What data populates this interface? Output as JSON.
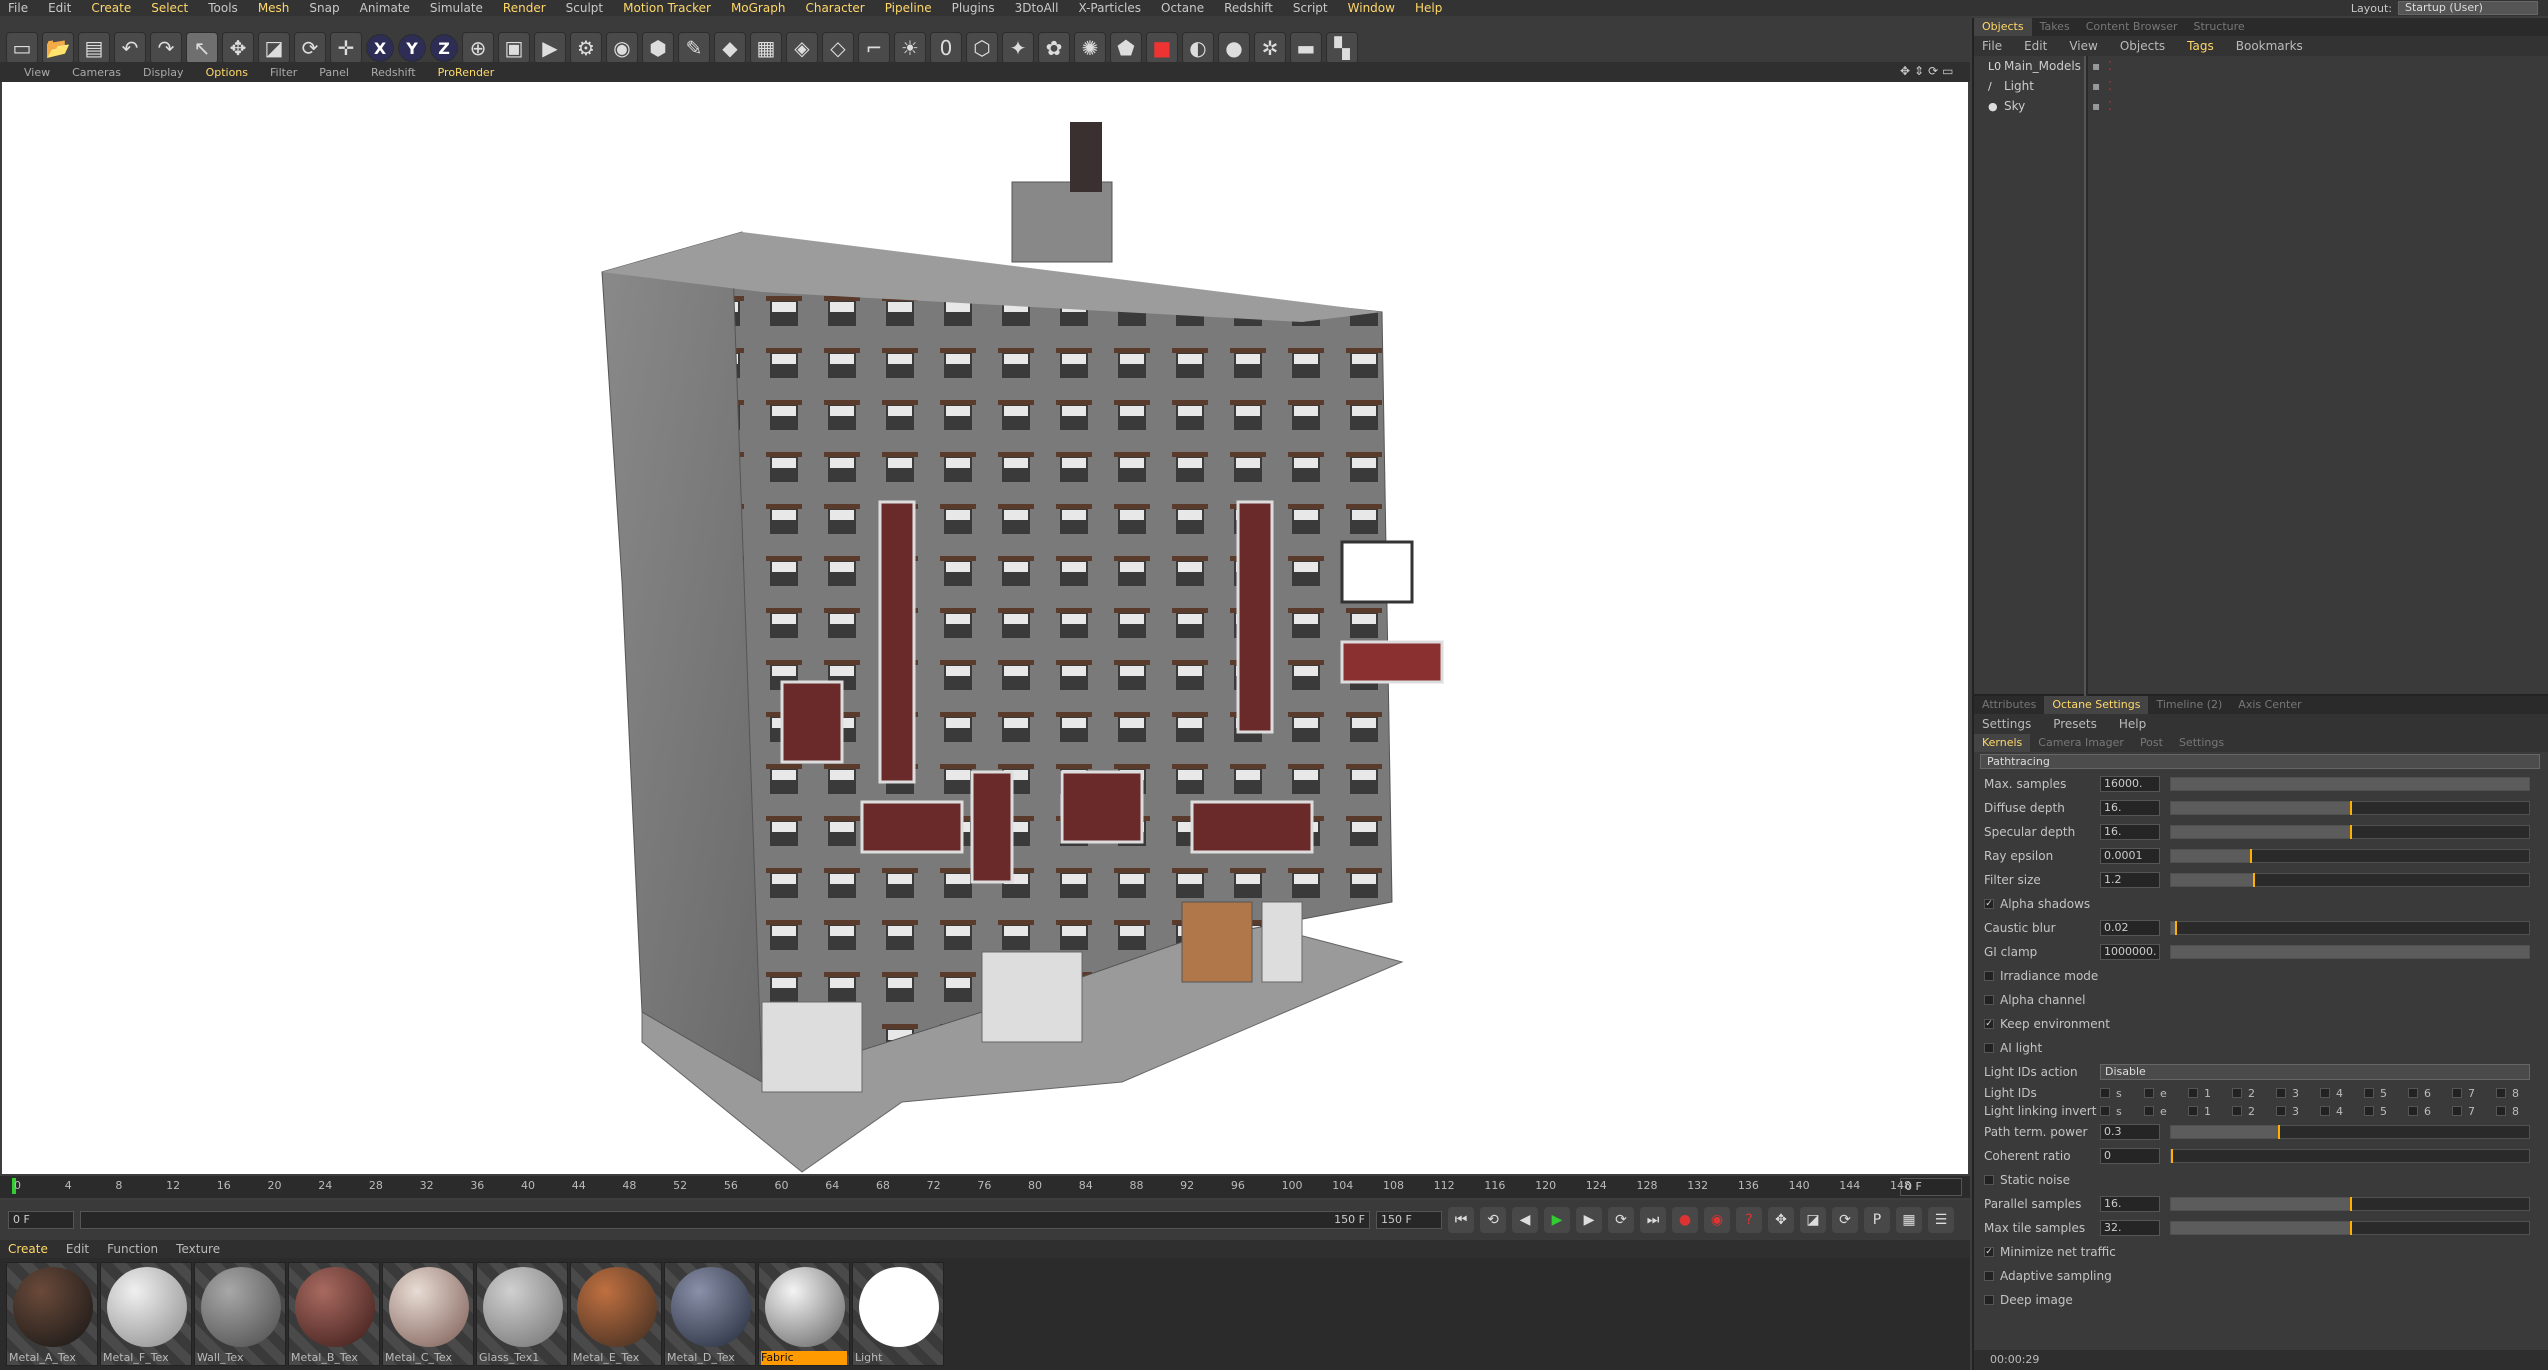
{
  "menu": [
    "File",
    "Edit",
    "Create",
    "Select",
    "Tools",
    "Mesh",
    "Snap",
    "Animate",
    "Simulate",
    "Render",
    "Sculpt",
    "Motion Tracker",
    "MoGraph",
    "Character",
    "Pipeline",
    "Plugins",
    "3DtoAll",
    "X-Particles",
    "Octane",
    "Redshift",
    "Script",
    "Window",
    "Help"
  ],
  "menu_highlight": [
    "Create",
    "Select",
    "Mesh",
    "Render",
    "Motion Tracker",
    "MoGraph",
    "Character",
    "Pipeline",
    "Window",
    "Help"
  ],
  "layout": {
    "label": "Layout:",
    "value": "Startup (User)"
  },
  "toolbar": {
    "x": "X",
    "y": "Y",
    "z": "Z",
    "zero": "0",
    "f": "F"
  },
  "viewport_menu": [
    {
      "label": "View",
      "hl": false
    },
    {
      "label": "Cameras",
      "hl": false
    },
    {
      "label": "Display",
      "hl": false
    },
    {
      "label": "Options",
      "hl": true
    },
    {
      "label": "Filter",
      "hl": false
    },
    {
      "label": "Panel",
      "hl": false
    },
    {
      "label": "Redshift",
      "hl": false
    },
    {
      "label": "ProRender",
      "hl": true
    }
  ],
  "timeline": {
    "ticks": [
      "0",
      "4",
      "8",
      "12",
      "16",
      "20",
      "24",
      "28",
      "32",
      "36",
      "40",
      "44",
      "48",
      "52",
      "56",
      "60",
      "64",
      "68",
      "72",
      "76",
      "80",
      "84",
      "88",
      "92",
      "96",
      "100",
      "104",
      "108",
      "112",
      "116",
      "120",
      "124",
      "128",
      "132",
      "136",
      "140",
      "144",
      "148"
    ],
    "current_frame": "0 F",
    "start": "0 F",
    "end_inner": "150 F",
    "end": "150 F"
  },
  "materials_menu": [
    {
      "label": "Create",
      "hl": true
    },
    {
      "label": "Edit",
      "hl": false
    },
    {
      "label": "Function",
      "hl": false
    },
    {
      "label": "Texture",
      "hl": false
    }
  ],
  "materials": [
    {
      "name": "Metal_A_Tex",
      "c1": "#6a4a3a",
      "c2": "#151515",
      "active": false
    },
    {
      "name": "Metal_F_Tex",
      "c1": "#f0f0f0",
      "c2": "#8a8a8a",
      "active": false
    },
    {
      "name": "Wall_Tex",
      "c1": "#a8a8a8",
      "c2": "#4a4a4a",
      "active": false
    },
    {
      "name": "Metal_B_Tex",
      "c1": "#a86a60",
      "c2": "#3a1a18",
      "active": false
    },
    {
      "name": "Metal_C_Tex",
      "c1": "#e8dcd4",
      "c2": "#7a5a52",
      "active": false
    },
    {
      "name": "Glass_Tex1",
      "c1": "#d0d0d0",
      "c2": "#707070",
      "active": false
    },
    {
      "name": "Metal_E_Tex",
      "c1": "#c07040",
      "c2": "#3a2a20",
      "active": false
    },
    {
      "name": "Metal_D_Tex",
      "c1": "#8a90a8",
      "c2": "#202838",
      "active": false
    },
    {
      "name": "Fabric",
      "c1": "#f4f4f4",
      "c2": "#606060",
      "active": true
    },
    {
      "name": "Light",
      "c1": "#ffffff",
      "c2": "#ffffff",
      "active": false
    }
  ],
  "objects_panel": {
    "tabs": [
      {
        "label": "Objects",
        "act": true
      },
      {
        "label": "Takes",
        "act": false
      },
      {
        "label": "Content Browser",
        "act": false
      },
      {
        "label": "Structure",
        "act": false
      }
    ],
    "menu": [
      {
        "label": "File",
        "hl": false
      },
      {
        "label": "Edit",
        "hl": false
      },
      {
        "label": "View",
        "hl": false
      },
      {
        "label": "Objects",
        "hl": false
      },
      {
        "label": "Tags",
        "hl": true
      },
      {
        "label": "Bookmarks",
        "hl": false
      }
    ],
    "items": [
      {
        "name": "Main_Models",
        "icon": "L0"
      },
      {
        "name": "Light",
        "icon": "/"
      },
      {
        "name": "Sky",
        "icon": "●"
      }
    ]
  },
  "attr_panel": {
    "tabs": [
      {
        "label": "Attributes",
        "act": false
      },
      {
        "label": "Octane Settings",
        "act": true
      },
      {
        "label": "Timeline (2)",
        "act": false
      },
      {
        "label": "Axis Center",
        "act": false
      }
    ],
    "menu": [
      {
        "label": "Settings",
        "hl": false
      },
      {
        "label": "Presets",
        "hl": false
      },
      {
        "label": "Help",
        "hl": false
      }
    ],
    "subtabs": [
      {
        "label": "Kernels",
        "act": true
      },
      {
        "label": "Camera Imager",
        "act": false
      },
      {
        "label": "Post",
        "act": false
      },
      {
        "label": "Settings",
        "act": false
      }
    ],
    "kernel": "Pathtracing",
    "params": [
      {
        "kind": "slider",
        "label": "Max. samples",
        "value": "16000.",
        "fill": 1.0,
        "mark": null
      },
      {
        "kind": "slider",
        "label": "Diffuse depth",
        "value": "16.",
        "fill": 0.5,
        "mark": 0.5
      },
      {
        "kind": "slider",
        "label": "Specular depth",
        "value": "16.",
        "fill": 0.5,
        "mark": 0.5
      },
      {
        "kind": "slider",
        "label": "Ray epsilon",
        "value": "0.0001",
        "fill": 0.22,
        "mark": 0.22
      },
      {
        "kind": "slider",
        "label": "Filter size",
        "value": "1.2",
        "fill": 0.23,
        "mark": 0.23
      },
      {
        "kind": "check",
        "label": "Alpha shadows",
        "checked": true
      },
      {
        "kind": "slider",
        "label": "Caustic blur",
        "value": "0.02",
        "fill": 0.01,
        "mark": 0.01
      },
      {
        "kind": "slider",
        "label": "GI clamp",
        "value": "1000000.",
        "fill": 1.0,
        "mark": null
      },
      {
        "kind": "check",
        "label": "Irradiance mode",
        "checked": false
      },
      {
        "kind": "check",
        "label": "Alpha channel",
        "checked": false
      },
      {
        "kind": "check",
        "label": "Keep environment",
        "checked": true
      },
      {
        "kind": "check",
        "label": "AI light",
        "checked": false
      },
      {
        "kind": "dropdown",
        "label": "Light IDs action",
        "value": "Disable"
      },
      {
        "kind": "ids",
        "label": "Light IDs",
        "ids": [
          "s",
          "e",
          "1",
          "2",
          "3",
          "4",
          "5",
          "6",
          "7",
          "8"
        ]
      },
      {
        "kind": "ids",
        "label": "Light linking invert",
        "ids": [
          "s",
          "e",
          "1",
          "2",
          "3",
          "4",
          "5",
          "6",
          "7",
          "8"
        ]
      },
      {
        "kind": "slider",
        "label": "Path term. power",
        "value": "0.3",
        "fill": 0.3,
        "mark": 0.3
      },
      {
        "kind": "slider",
        "label": "Coherent ratio",
        "value": "0",
        "fill": 0,
        "mark": 0.0
      },
      {
        "kind": "check",
        "label": "Static noise",
        "checked": false
      },
      {
        "kind": "slider",
        "label": "Parallel samples",
        "value": "16.",
        "fill": 0.5,
        "mark": 0.5
      },
      {
        "kind": "slider",
        "label": "Max tile samples",
        "value": "32.",
        "fill": 0.5,
        "mark": 0.5
      },
      {
        "kind": "check",
        "label": "Minimize net traffic",
        "checked": true
      },
      {
        "kind": "check",
        "label": "Adaptive sampling",
        "checked": false
      },
      {
        "kind": "check",
        "label": "Deep image",
        "checked": false
      }
    ],
    "status": "00:00:29"
  },
  "colors": {
    "accent": "#ffd86a",
    "active_material": "#ff9b00",
    "slider_mark": "#ffb000"
  }
}
